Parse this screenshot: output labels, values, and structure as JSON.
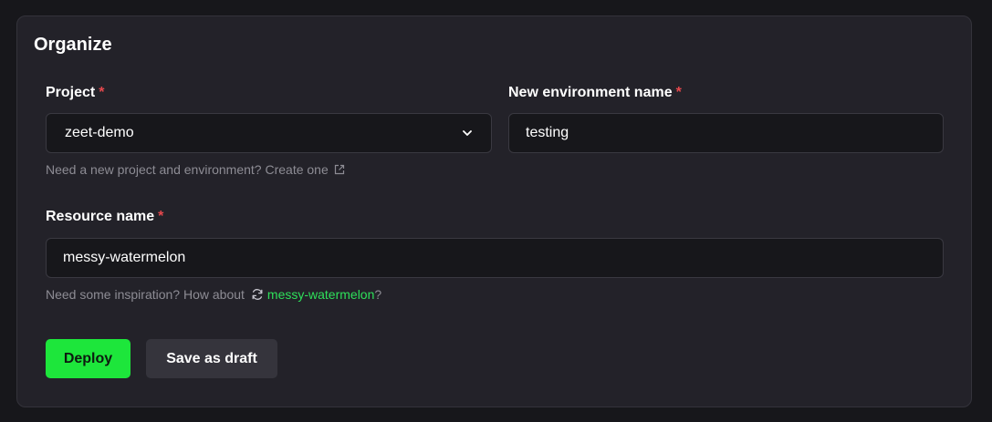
{
  "card": {
    "title": "Organize"
  },
  "project": {
    "label": "Project",
    "required_mark": "*",
    "value": "zeet-demo",
    "helper_text": "Need a new project and environment? Create one"
  },
  "environment": {
    "label": "New environment name",
    "required_mark": "*",
    "value": "testing"
  },
  "resource": {
    "label": "Resource name",
    "required_mark": "*",
    "value": "messy-watermelon",
    "helper_prefix": "Need some inspiration? How about",
    "suggestion": "messy-watermelon",
    "helper_suffix": "?"
  },
  "actions": {
    "deploy_label": "Deploy",
    "save_draft_label": "Save as draft"
  },
  "colors": {
    "accent": "#1de63b",
    "suggestion_link": "#2ee05a",
    "required": "#e5484d",
    "card_bg": "#232229",
    "page_bg": "#17171b"
  },
  "icons": {
    "select_chevron": "chevron-down-icon",
    "create_link": "external-link-icon",
    "suggestion": "refresh-icon"
  }
}
